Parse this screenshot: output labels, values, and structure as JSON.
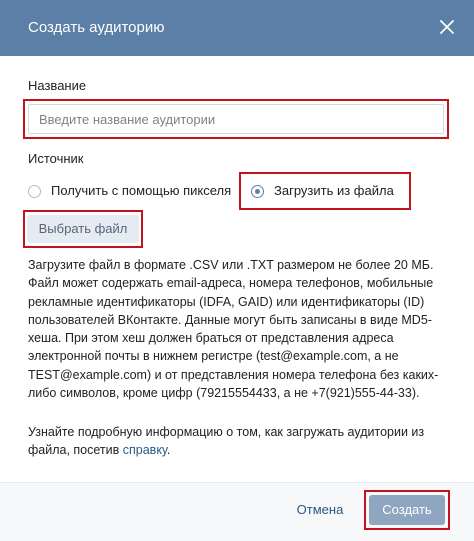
{
  "dialog": {
    "title": "Создать аудиторию",
    "close_icon": "close-icon"
  },
  "name_field": {
    "label": "Название",
    "placeholder": "Введите название аудитории",
    "value": ""
  },
  "source": {
    "label": "Источник",
    "options": [
      {
        "label": "Получить с помощью пикселя",
        "checked": false
      },
      {
        "label": "Загрузить из файла",
        "checked": true
      }
    ]
  },
  "file_button": {
    "label": "Выбрать файл"
  },
  "description": {
    "lines": [
      "Загрузите файл в формате .CSV или .TXT размером не более 20 МБ.",
      "Файл может содержать email-адреса, номера телефонов, мобильные",
      "рекламные идентификаторы (IDFA, GAID) или идентификаторы (ID)",
      "пользователей ВКонтакте. Данные могут быть записаны в виде MD5-",
      "хеша. При этом хеш должен браться от представления адреса",
      "электронной почты в нижнем регистре (test@example.com, а не",
      "TEST@example.com) и от представления номера телефона без каких-",
      "либо символов, кроме цифр (79215554433, а не +7(921)555-44-33)."
    ]
  },
  "info": {
    "line1": "Узнайте подробную информацию о том, как загружать аудитории из",
    "line2_prefix": "файла, посетив ",
    "link": "справку",
    "line2_suffix": "."
  },
  "footer": {
    "cancel_label": "Отмена",
    "create_label": "Создать"
  },
  "colors": {
    "header": "#5b7fa6",
    "highlight": "#c1121f",
    "link": "#2a5885",
    "create_button": "#8fa6c1"
  }
}
